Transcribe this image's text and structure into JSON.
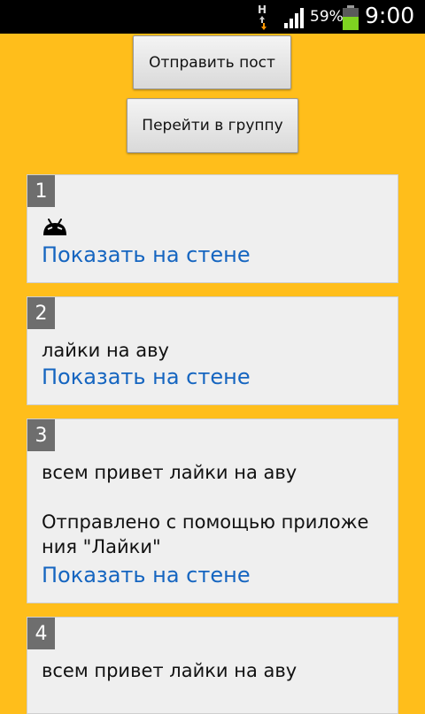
{
  "status_bar": {
    "network_letter": "H",
    "battery_percent": "59%",
    "time": "9:00"
  },
  "actions": {
    "send_post": "Отправить пост",
    "go_to_group": "Перейти в группу"
  },
  "posts": [
    {
      "number": "1",
      "text": "",
      "icon": "android-icon",
      "link": "Показать на стене"
    },
    {
      "number": "2",
      "text": "лайки на аву",
      "link": "Показать на стене"
    },
    {
      "number": "3",
      "text": "всем привет лайки на аву\n\nОтправлено с помощью приложе\nния \"Лайки\"",
      "link": "Показать на стене"
    },
    {
      "number": "4",
      "text": "всем привет лайки на аву",
      "link": ""
    }
  ]
}
